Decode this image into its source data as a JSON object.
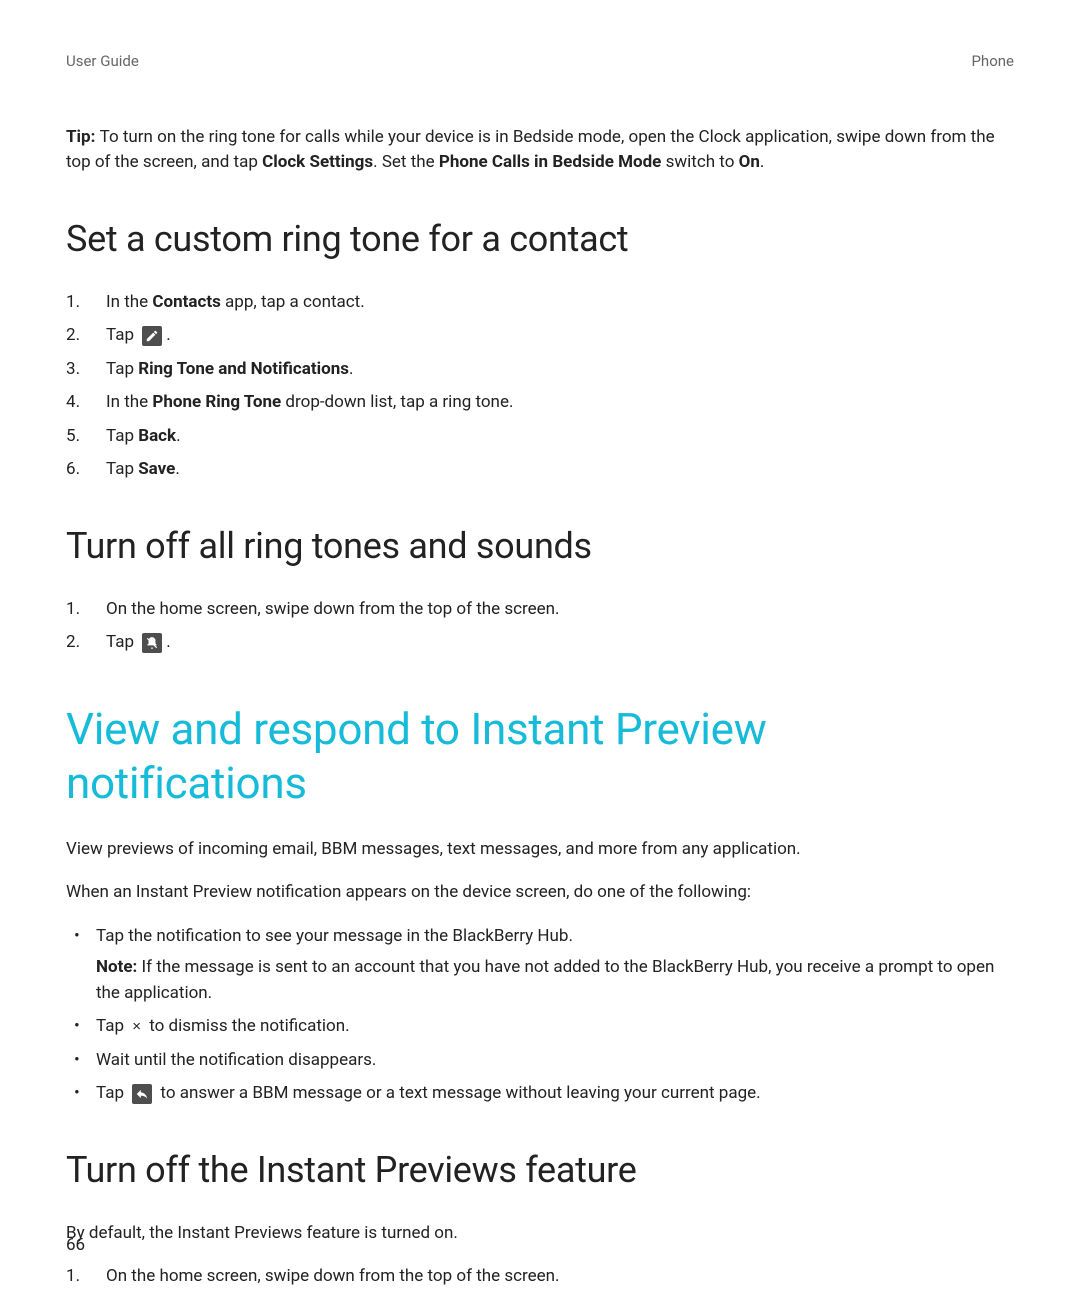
{
  "header": {
    "left": "User Guide",
    "right": "Phone"
  },
  "tip": {
    "label": "Tip: ",
    "pre": "To turn on the ring tone for calls while your device is in Bedside mode, open the Clock application, swipe down from the top of the screen, and tap ",
    "bold1": "Clock Settings",
    "mid": ". Set the ",
    "bold2": "Phone Calls in Bedside Mode",
    "post": " switch to ",
    "bold3": "On",
    "period": "."
  },
  "section1": {
    "title": "Set a custom ring tone for a contact",
    "step1_pre": "In the ",
    "step1_bold": "Contacts",
    "step1_post": " app, tap a contact.",
    "step2_pre": "Tap ",
    "step2_post": ".",
    "step3_pre": "Tap ",
    "step3_bold": "Ring Tone and Notifications",
    "step3_post": ".",
    "step4_pre": "In the ",
    "step4_bold": "Phone Ring Tone",
    "step4_post": " drop-down list, tap a ring tone.",
    "step5_pre": "Tap ",
    "step5_bold": "Back",
    "step5_post": ".",
    "step6_pre": "Tap ",
    "step6_bold": "Save",
    "step6_post": "."
  },
  "section2": {
    "title": "Turn off all ring tones and sounds",
    "step1": "On the home screen, swipe down from the top of the screen.",
    "step2_pre": "Tap ",
    "step2_post": "."
  },
  "section3": {
    "title": "View and respond to Instant Preview notifications",
    "p1": "View previews of incoming email, BBM messages, text messages, and more from any application.",
    "p2": "When an Instant Preview notification appears on the device screen, do one of the following:",
    "bullet1": "Tap the notification to see your message in the BlackBerry Hub.",
    "bullet1_note_label": "Note: ",
    "bullet1_note": "If the message is sent to an account that you have not added to the BlackBerry Hub, you receive a prompt to open the application.",
    "bullet2_pre": "Tap ",
    "bullet2_mid": " to dismiss the notification.",
    "bullet3": "Wait until the notification disappears.",
    "bullet4_pre": "Tap ",
    "bullet4_post": " to answer a BBM message or a text message without leaving your current page."
  },
  "section4": {
    "title": "Turn off the Instant Previews feature",
    "p1": "By default, the Instant Previews feature is turned on.",
    "step1": "On the home screen, swipe down from the top of the screen."
  },
  "page_number": "66",
  "icons": {
    "edit": "edit-icon",
    "mute": "mute-icon",
    "close_x": "×",
    "reply": "reply-icon"
  }
}
